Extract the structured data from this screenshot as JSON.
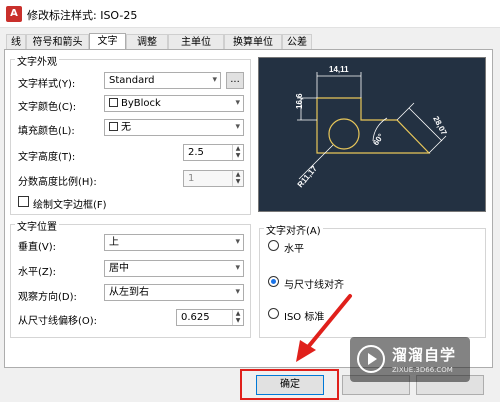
{
  "window": {
    "title": "修改标注样式: ISO-25"
  },
  "tabs": [
    {
      "label": "线"
    },
    {
      "label": "符号和箭头"
    },
    {
      "label": "文字"
    },
    {
      "label": "调整"
    },
    {
      "label": "主单位"
    },
    {
      "label": "换算单位"
    },
    {
      "label": "公差"
    }
  ],
  "active_tab": "文字",
  "text_appearance": {
    "legend": "文字外观",
    "style_label": "文字样式(Y):",
    "style_value": "Standard",
    "style_button": "...",
    "color_label": "文字颜色(C):",
    "color_value": "ByBlock",
    "fill_label": "填充颜色(L):",
    "fill_value": "无",
    "height_label": "文字高度(T):",
    "height_value": "2.5",
    "fraction_label": "分数高度比例(H):",
    "fraction_value": "1",
    "frame_label": "绘制文字边框(F)"
  },
  "text_placement": {
    "legend": "文字位置",
    "vertical_label": "垂直(V):",
    "vertical_value": "上",
    "horizontal_label": "水平(Z):",
    "horizontal_value": "居中",
    "view_label": "观察方向(D):",
    "view_value": "从左到右",
    "offset_label": "从尺寸线偏移(O):",
    "offset_value": "0.625"
  },
  "text_alignment": {
    "legend": "文字对齐(A)",
    "options": [
      "水平",
      "与尺寸线对齐",
      "ISO 标准"
    ],
    "selected": "与尺寸线对齐"
  },
  "preview": {
    "dim_top": "14,11",
    "dim_left": "16,6",
    "dim_right": "28,07",
    "dim_angle": "60°",
    "dim_radius": "R11,17"
  },
  "buttons": {
    "ok": "确定"
  },
  "watermark": {
    "title": "溜溜自学",
    "subtitle": "ZIXUE.3D66.COM"
  },
  "colors": {
    "highlight": "#e0201b",
    "preview_bg": "#233142",
    "preview_lines": "#e8c75a",
    "preview_dims": "#ffffff"
  }
}
